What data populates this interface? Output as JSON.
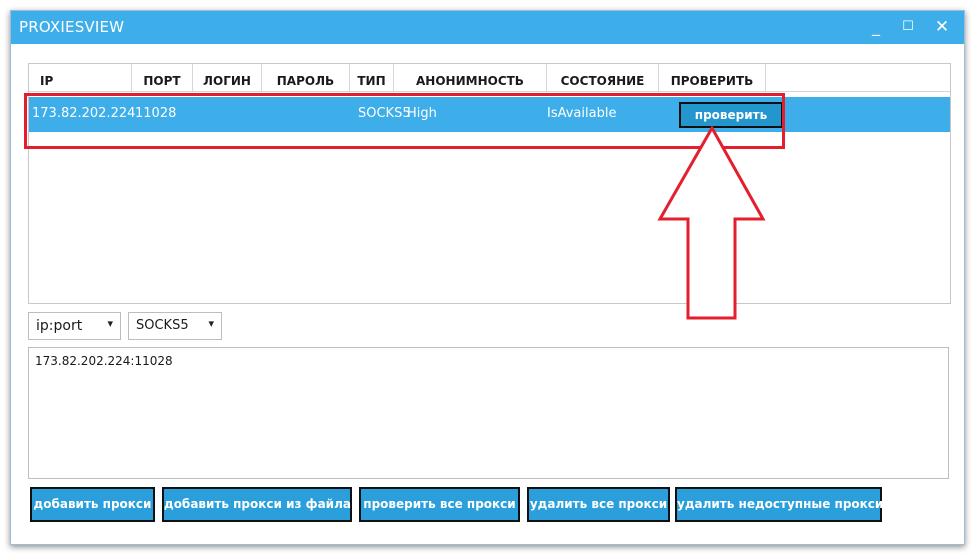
{
  "window": {
    "title": "PROXIESVIEW",
    "minimize_label": "_",
    "maximize_label": "☐",
    "close_label": "✕"
  },
  "table": {
    "columns": [
      "IP",
      "ПОРТ",
      "ЛОГИН",
      "ПАРОЛЬ",
      "ТИП",
      "АНОНИМНОСТЬ",
      "СОСТОЯНИЕ",
      "ПРОВЕРИТЬ"
    ],
    "rows": [
      {
        "ip": "173.82.202.224",
        "port": "11028",
        "login": "",
        "password": "",
        "type": "SOCKS5",
        "anonymity": "High",
        "status": "IsAvailable",
        "check_label": "проверить"
      }
    ]
  },
  "controls": {
    "format_select": "ip:port",
    "protocol_select": "SOCKS5",
    "proxy_text": "173.82.202.224:11028"
  },
  "actions": {
    "add_proxy": "добавить прокси",
    "add_from_file": "добавить прокси из файла",
    "check_all": "проверить все прокси",
    "delete_all": "удалить все прокси",
    "delete_unavailable": "удалить недоступные прокси"
  },
  "colors": {
    "accent": "#3daee9",
    "annotation": "#e31e2d"
  },
  "icons": {
    "select_chevron": "▾"
  }
}
